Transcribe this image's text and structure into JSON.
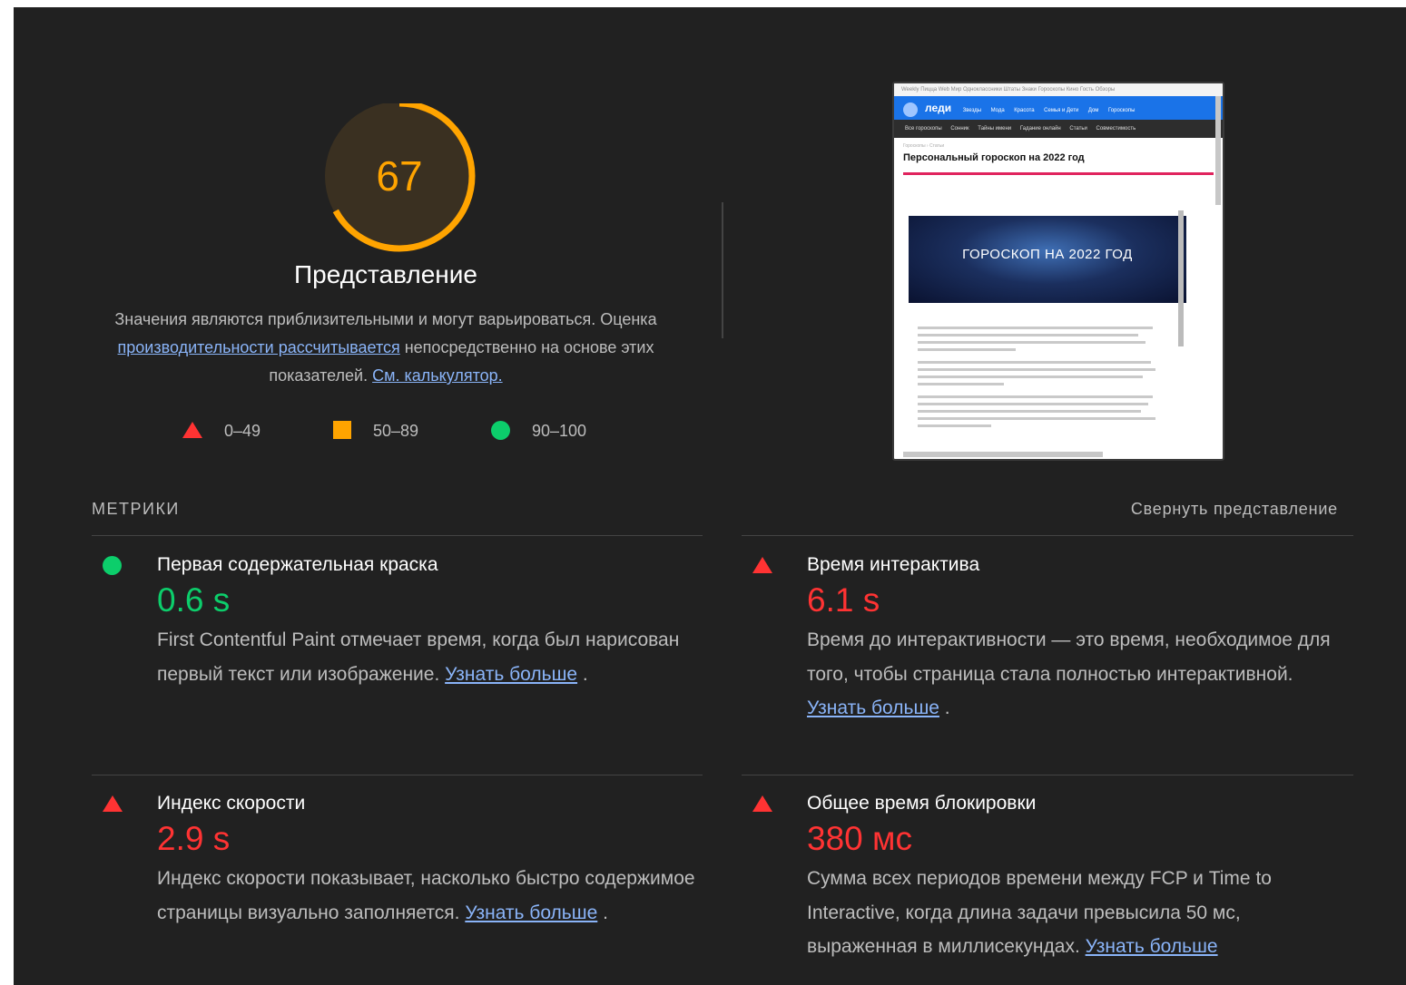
{
  "gauge": {
    "score": "67",
    "score_fraction": 0.67,
    "color": "#ffa400",
    "title": "Представление",
    "desc_part1": "Значения являются приблизительными и могут варьироваться. Оценка ",
    "desc_link1": "производительности рассчитывается",
    "desc_part2": " непосредственно на основе этих показателей. ",
    "desc_link2": "См. калькулятор."
  },
  "legend": [
    {
      "icon": "triangle",
      "label": "0–49",
      "color": "#ff3333"
    },
    {
      "icon": "square",
      "label": "50–89",
      "color": "#ffa400"
    },
    {
      "icon": "circle",
      "label": "90–100",
      "color": "#0cce6b"
    }
  ],
  "thumbnail": {
    "topbar": "Weekly   Пицца   Web Мир   Одноклассники   Штаты   Знаки   Гороскопы   Кино   Гость   Обзоры",
    "logo": "леди",
    "nav_items": [
      "Звезды",
      "Мода",
      "Красота",
      "Семья и Дети",
      "Дом",
      "Гороскопы"
    ],
    "subnav_items": [
      "Все гороскопы",
      "Сонник",
      "Тайны имени",
      "Гадание онлайн",
      "Статьи",
      "Совместимость"
    ],
    "crumb": "Гороскопы › Статьи",
    "title": "Персональный гороскоп на 2022 год",
    "banner": "ГОРОСКОП НА 2022 ГОД"
  },
  "metrics_section": {
    "label": "МЕТРИКИ",
    "toggle": "Свернуть представление"
  },
  "metrics": [
    {
      "status": "pass",
      "icon": "circle",
      "title": "Первая содержательная краска",
      "value": "0.6 s",
      "desc": "First Contentful Paint отмечает время, когда был нарисован первый текст или изображение. ",
      "link": "Узнать больше",
      "tail": " ."
    },
    {
      "status": "fail",
      "icon": "triangle",
      "title": "Время интерактива",
      "value": "6.1 s",
      "desc": "Время до интерактивности — это время, необходимое для того, чтобы страница стала полностью интерактивной. ",
      "link": "Узнать больше",
      "tail": " ."
    },
    {
      "status": "fail",
      "icon": "triangle",
      "title": "Индекс скорости",
      "value": "2.9 s",
      "desc": "Индекс скорости показывает, насколько быстро содержимое страницы визуально заполняется. ",
      "link": "Узнать больше",
      "tail": " ."
    },
    {
      "status": "fail",
      "icon": "triangle",
      "title": "Общее время блокировки",
      "value": "380 мс",
      "desc": "Сумма всех периодов времени между FCP и Time to Interactive, когда длина задачи превысила 50 мс, выраженная в миллисекундах. ",
      "link": "Узнать больше",
      "tail": ""
    }
  ]
}
